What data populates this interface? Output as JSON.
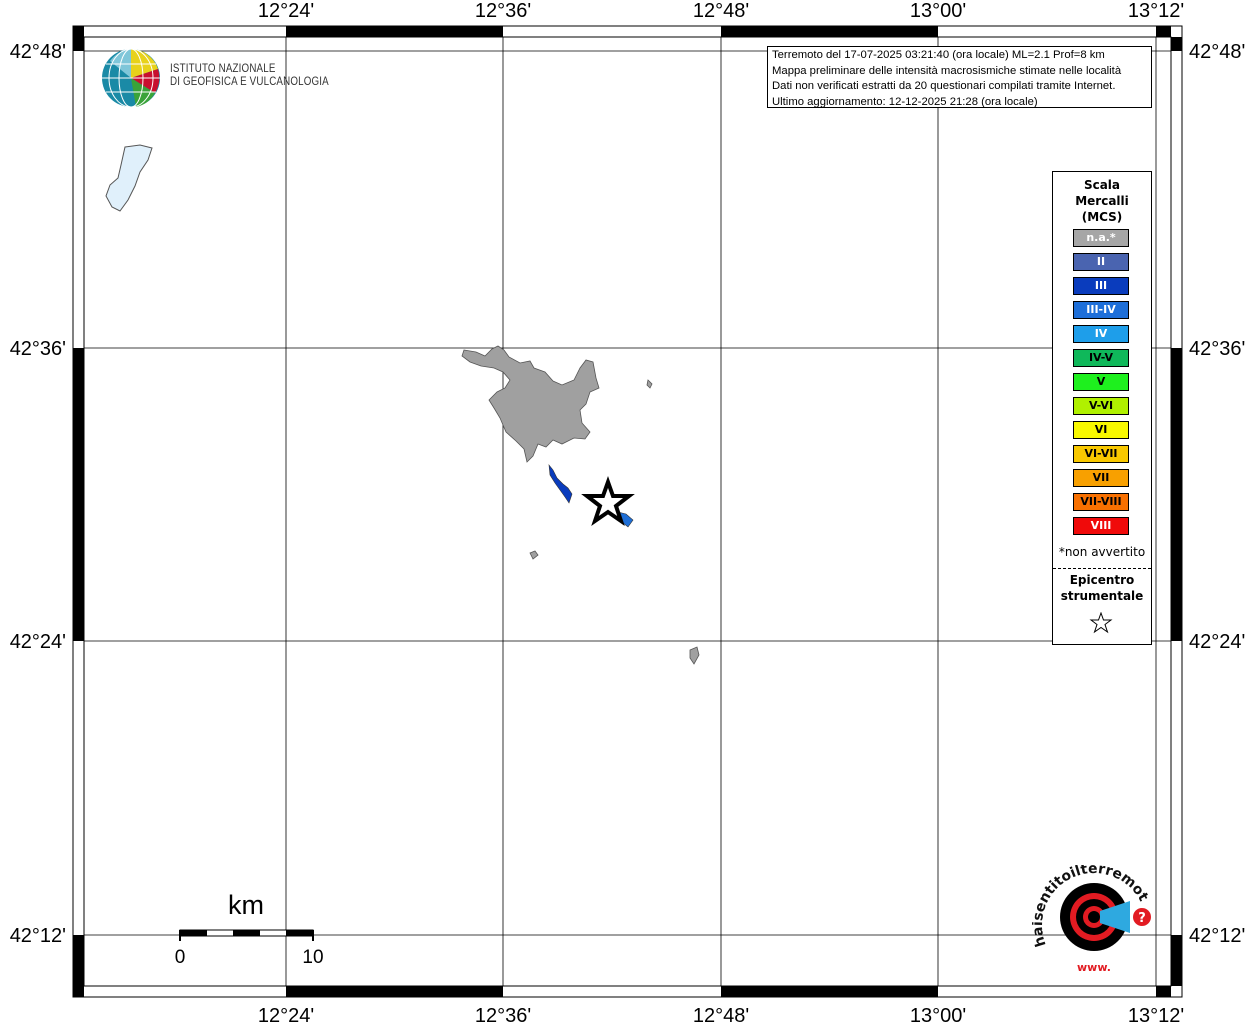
{
  "map": {
    "top_lon_labels": [
      "12°24'",
      "12°36'",
      "12°48'",
      "13°00'",
      "13°12'"
    ],
    "bottom_lon_labels": [
      "12°24'",
      "12°36'",
      "12°48'",
      "13°00'",
      "13°12'"
    ],
    "left_lat_labels": [
      "42°48'",
      "42°36'",
      "42°24'",
      "42°12'"
    ],
    "right_lat_labels": [
      "42°48'",
      "42°36'",
      "42°24'",
      "42°12'"
    ],
    "lake_color": "#e0f0fb",
    "felt_area_color": "#a0a0a0",
    "intensity_iii_color": "#0a3cbd",
    "intensity_iii_iv_color": "#1f6fd6"
  },
  "scale_bar": {
    "unit": "km",
    "min_label": "0",
    "max_label": "10"
  },
  "info": {
    "line1": "Terremoto del 17-07-2025 03:21:40 (ora locale) ML=2.1 Prof=8 km",
    "line2": "Mappa preliminare delle intensità macrosismiche stimate nelle località",
    "line3": "Dati non verificati estratti da 20 questionari compilati tramite Internet.",
    "line4": "Ultimo aggiornamento: 12-12-2025 21:28 (ora locale)"
  },
  "legend": {
    "title_line1": "Scala",
    "title_line2": "Mercalli",
    "title_line3": "(MCS)",
    "items": [
      {
        "label": "n.a.*",
        "color": "#a6a6a6",
        "text_color": "#ffffff"
      },
      {
        "label": "II",
        "color": "#4a64b0",
        "text_color": "#ffffff"
      },
      {
        "label": "III",
        "color": "#0a3cbd",
        "text_color": "#ffffff"
      },
      {
        "label": "III-IV",
        "color": "#1e6fd9",
        "text_color": "#ffffff"
      },
      {
        "label": "IV",
        "color": "#1e9eea",
        "text_color": "#ffffff"
      },
      {
        "label": "IV-V",
        "color": "#0fb85a",
        "text_color": "#000000"
      },
      {
        "label": "V",
        "color": "#1ef01e",
        "text_color": "#000000"
      },
      {
        "label": "V-VI",
        "color": "#b0f000",
        "text_color": "#000000"
      },
      {
        "label": "VI",
        "color": "#f8f800",
        "text_color": "#000000"
      },
      {
        "label": "VI-VII",
        "color": "#f8c800",
        "text_color": "#000000"
      },
      {
        "label": "VII",
        "color": "#f8a000",
        "text_color": "#000000"
      },
      {
        "label": "VII-VIII",
        "color": "#f87000",
        "text_color": "#000000"
      },
      {
        "label": "VIII",
        "color": "#f00a0a",
        "text_color": "#ffffff"
      }
    ],
    "na_note": "*non avvertito",
    "epicenter_line1": "Epicentro",
    "epicenter_line2": "strumentale"
  },
  "logos": {
    "ingv_line1": "ISTITUTO NAZIONALE",
    "ingv_line2": "DI GEOFISICA E VULCANOLOGIA",
    "hst_text": "haisentitoilterremoto.it",
    "hst_prefix": "www."
  }
}
